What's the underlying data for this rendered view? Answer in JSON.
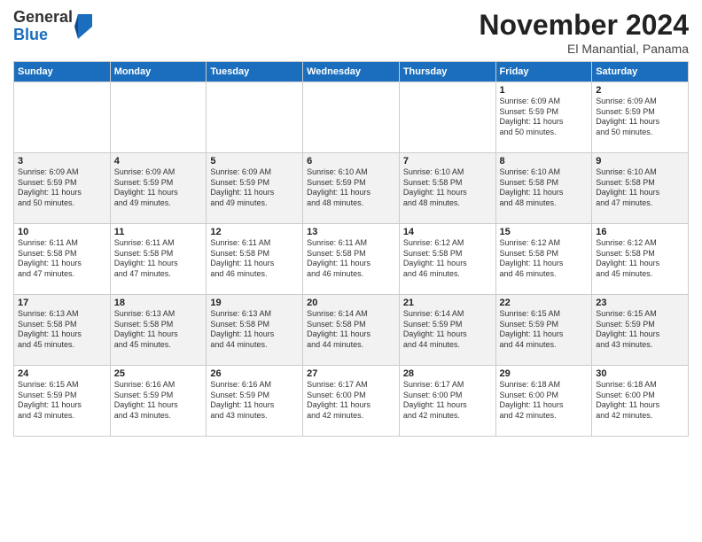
{
  "logo": {
    "general": "General",
    "blue": "Blue"
  },
  "title": "November 2024",
  "subtitle": "El Manantial, Panama",
  "days_header": [
    "Sunday",
    "Monday",
    "Tuesday",
    "Wednesday",
    "Thursday",
    "Friday",
    "Saturday"
  ],
  "weeks": [
    [
      {
        "day": "",
        "info": ""
      },
      {
        "day": "",
        "info": ""
      },
      {
        "day": "",
        "info": ""
      },
      {
        "day": "",
        "info": ""
      },
      {
        "day": "",
        "info": ""
      },
      {
        "day": "1",
        "info": "Sunrise: 6:09 AM\nSunset: 5:59 PM\nDaylight: 11 hours\nand 50 minutes."
      },
      {
        "day": "2",
        "info": "Sunrise: 6:09 AM\nSunset: 5:59 PM\nDaylight: 11 hours\nand 50 minutes."
      }
    ],
    [
      {
        "day": "3",
        "info": "Sunrise: 6:09 AM\nSunset: 5:59 PM\nDaylight: 11 hours\nand 50 minutes."
      },
      {
        "day": "4",
        "info": "Sunrise: 6:09 AM\nSunset: 5:59 PM\nDaylight: 11 hours\nand 49 minutes."
      },
      {
        "day": "5",
        "info": "Sunrise: 6:09 AM\nSunset: 5:59 PM\nDaylight: 11 hours\nand 49 minutes."
      },
      {
        "day": "6",
        "info": "Sunrise: 6:10 AM\nSunset: 5:59 PM\nDaylight: 11 hours\nand 48 minutes."
      },
      {
        "day": "7",
        "info": "Sunrise: 6:10 AM\nSunset: 5:58 PM\nDaylight: 11 hours\nand 48 minutes."
      },
      {
        "day": "8",
        "info": "Sunrise: 6:10 AM\nSunset: 5:58 PM\nDaylight: 11 hours\nand 48 minutes."
      },
      {
        "day": "9",
        "info": "Sunrise: 6:10 AM\nSunset: 5:58 PM\nDaylight: 11 hours\nand 47 minutes."
      }
    ],
    [
      {
        "day": "10",
        "info": "Sunrise: 6:11 AM\nSunset: 5:58 PM\nDaylight: 11 hours\nand 47 minutes."
      },
      {
        "day": "11",
        "info": "Sunrise: 6:11 AM\nSunset: 5:58 PM\nDaylight: 11 hours\nand 47 minutes."
      },
      {
        "day": "12",
        "info": "Sunrise: 6:11 AM\nSunset: 5:58 PM\nDaylight: 11 hours\nand 46 minutes."
      },
      {
        "day": "13",
        "info": "Sunrise: 6:11 AM\nSunset: 5:58 PM\nDaylight: 11 hours\nand 46 minutes."
      },
      {
        "day": "14",
        "info": "Sunrise: 6:12 AM\nSunset: 5:58 PM\nDaylight: 11 hours\nand 46 minutes."
      },
      {
        "day": "15",
        "info": "Sunrise: 6:12 AM\nSunset: 5:58 PM\nDaylight: 11 hours\nand 46 minutes."
      },
      {
        "day": "16",
        "info": "Sunrise: 6:12 AM\nSunset: 5:58 PM\nDaylight: 11 hours\nand 45 minutes."
      }
    ],
    [
      {
        "day": "17",
        "info": "Sunrise: 6:13 AM\nSunset: 5:58 PM\nDaylight: 11 hours\nand 45 minutes."
      },
      {
        "day": "18",
        "info": "Sunrise: 6:13 AM\nSunset: 5:58 PM\nDaylight: 11 hours\nand 45 minutes."
      },
      {
        "day": "19",
        "info": "Sunrise: 6:13 AM\nSunset: 5:58 PM\nDaylight: 11 hours\nand 44 minutes."
      },
      {
        "day": "20",
        "info": "Sunrise: 6:14 AM\nSunset: 5:58 PM\nDaylight: 11 hours\nand 44 minutes."
      },
      {
        "day": "21",
        "info": "Sunrise: 6:14 AM\nSunset: 5:59 PM\nDaylight: 11 hours\nand 44 minutes."
      },
      {
        "day": "22",
        "info": "Sunrise: 6:15 AM\nSunset: 5:59 PM\nDaylight: 11 hours\nand 44 minutes."
      },
      {
        "day": "23",
        "info": "Sunrise: 6:15 AM\nSunset: 5:59 PM\nDaylight: 11 hours\nand 43 minutes."
      }
    ],
    [
      {
        "day": "24",
        "info": "Sunrise: 6:15 AM\nSunset: 5:59 PM\nDaylight: 11 hours\nand 43 minutes."
      },
      {
        "day": "25",
        "info": "Sunrise: 6:16 AM\nSunset: 5:59 PM\nDaylight: 11 hours\nand 43 minutes."
      },
      {
        "day": "26",
        "info": "Sunrise: 6:16 AM\nSunset: 5:59 PM\nDaylight: 11 hours\nand 43 minutes."
      },
      {
        "day": "27",
        "info": "Sunrise: 6:17 AM\nSunset: 6:00 PM\nDaylight: 11 hours\nand 42 minutes."
      },
      {
        "day": "28",
        "info": "Sunrise: 6:17 AM\nSunset: 6:00 PM\nDaylight: 11 hours\nand 42 minutes."
      },
      {
        "day": "29",
        "info": "Sunrise: 6:18 AM\nSunset: 6:00 PM\nDaylight: 11 hours\nand 42 minutes."
      },
      {
        "day": "30",
        "info": "Sunrise: 6:18 AM\nSunset: 6:00 PM\nDaylight: 11 hours\nand 42 minutes."
      }
    ]
  ]
}
